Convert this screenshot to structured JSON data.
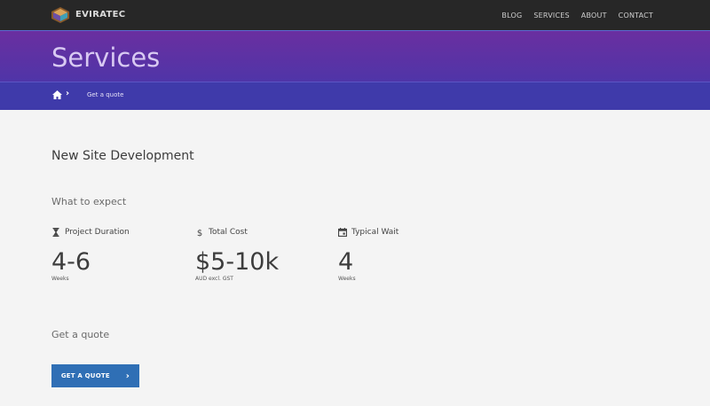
{
  "header": {
    "brand": "EVIRATEC",
    "nav": [
      "BLOG",
      "SERVICES",
      "ABOUT",
      "CONTACT"
    ]
  },
  "hero": {
    "title": "Services",
    "breadcrumb": "Get a quote"
  },
  "main": {
    "section_title": "New Site Development",
    "expect_heading": "What to expect",
    "stats": [
      {
        "icon": "hourglass-icon",
        "label": "Project Duration",
        "value": "4-6",
        "unit": "Weeks"
      },
      {
        "icon": "dollar-icon",
        "label": "Total Cost",
        "value": "$5-10k",
        "unit": "AUD excl. GST"
      },
      {
        "icon": "calendar-icon",
        "label": "Typical Wait",
        "value": "4",
        "unit": "Weeks"
      }
    ],
    "quote_heading": "Get a quote",
    "quote_button": "GET A QUOTE"
  },
  "colors": {
    "topbar": "#272727",
    "hero_top": "#6a2fa0",
    "hero_bottom": "#4f35a8",
    "crumbbar": "#3f3aaa",
    "button": "#2f6fb5"
  }
}
